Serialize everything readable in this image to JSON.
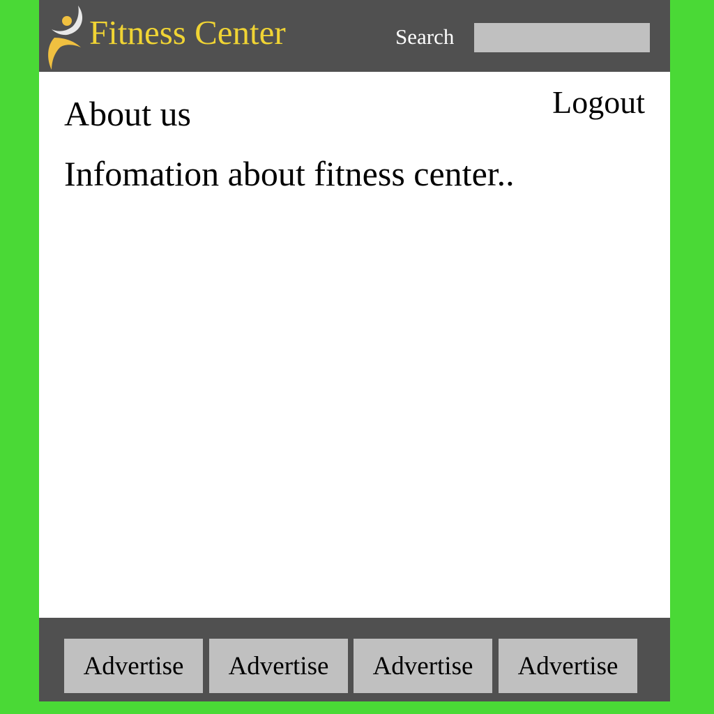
{
  "header": {
    "brand": "Fitness Center",
    "search_label": "Search",
    "search_value": "",
    "logo_icon": "fitness-person-logo"
  },
  "main": {
    "logout_label": "Logout",
    "title": "About us",
    "info": "Infomation about fitness center.."
  },
  "footer": {
    "ads": [
      {
        "label": "Advertise"
      },
      {
        "label": "Advertise"
      },
      {
        "label": "Advertise"
      },
      {
        "label": "Advertise"
      }
    ]
  },
  "colors": {
    "background": "#4ad936",
    "bar": "#505050",
    "brand": "#f0d434",
    "box": "#c0c0c0"
  }
}
